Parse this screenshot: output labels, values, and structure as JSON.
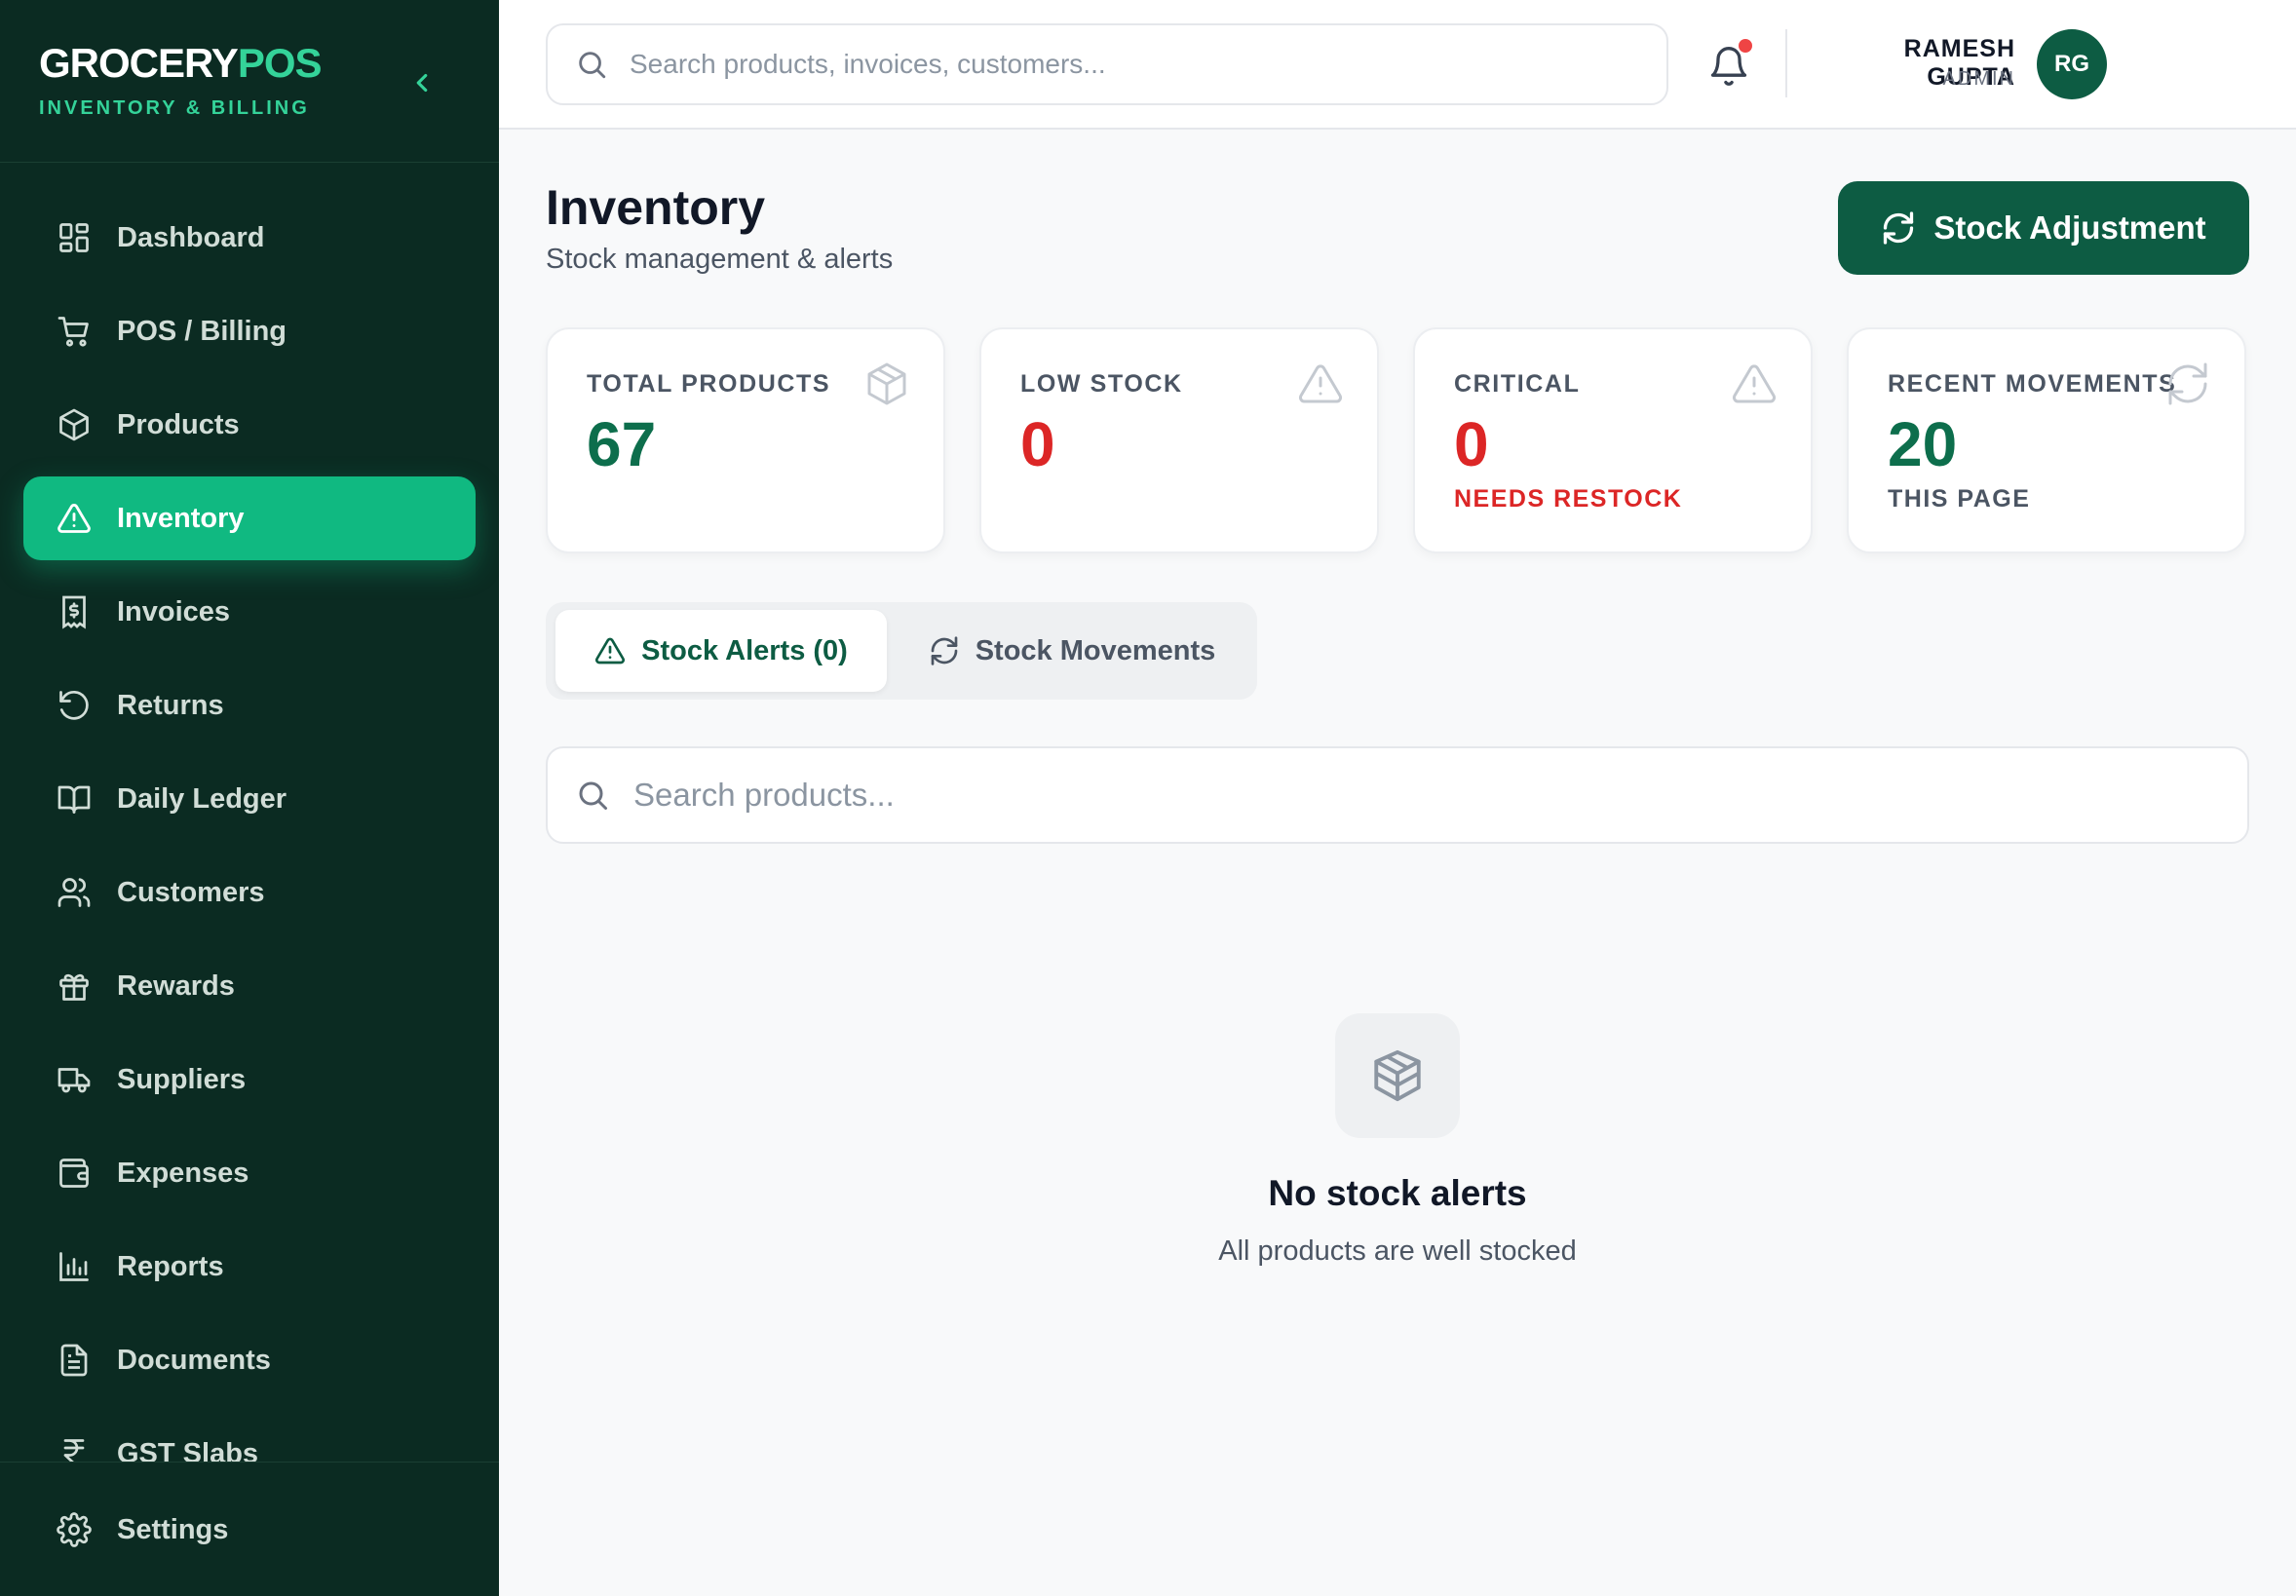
{
  "brand": {
    "name_part1": "GROCERY",
    "name_part2": "POS",
    "subtitle": "INVENTORY & BILLING"
  },
  "sidebar": {
    "items": [
      {
        "label": "Dashboard",
        "icon": "dashboard-icon"
      },
      {
        "label": "POS / Billing",
        "icon": "cart-icon"
      },
      {
        "label": "Products",
        "icon": "package-icon"
      },
      {
        "label": "Inventory",
        "icon": "alert-triangle-icon",
        "active": true
      },
      {
        "label": "Invoices",
        "icon": "receipt-icon"
      },
      {
        "label": "Returns",
        "icon": "rotate-ccw-icon"
      },
      {
        "label": "Daily Ledger",
        "icon": "book-open-icon"
      },
      {
        "label": "Customers",
        "icon": "users-icon"
      },
      {
        "label": "Rewards",
        "icon": "gift-icon"
      },
      {
        "label": "Suppliers",
        "icon": "truck-icon"
      },
      {
        "label": "Expenses",
        "icon": "wallet-icon"
      },
      {
        "label": "Reports",
        "icon": "bar-chart-icon"
      },
      {
        "label": "Documents",
        "icon": "file-text-icon"
      },
      {
        "label": "GST Slabs",
        "icon": "rupee-icon"
      }
    ],
    "settings_label": "Settings"
  },
  "header": {
    "search_placeholder": "Search products, invoices, customers...",
    "user_name": "RAMESH GUPTA",
    "user_role": "ADMIN",
    "avatar_initials": "RG"
  },
  "page": {
    "title": "Inventory",
    "subtitle": "Stock management & alerts",
    "action_button": "Stock Adjustment"
  },
  "stats": [
    {
      "label": "TOTAL PRODUCTS",
      "value": "67",
      "note": "",
      "icon": "box-icon"
    },
    {
      "label": "LOW STOCK",
      "value": "0",
      "note": "",
      "icon": "alert-triangle-icon"
    },
    {
      "label": "CRITICAL",
      "value": "0",
      "note": "NEEDS RESTOCK",
      "icon": "alert-triangle-icon"
    },
    {
      "label": "RECENT MOVEMENTS",
      "value": "20",
      "note": "THIS PAGE",
      "icon": "refresh-icon"
    }
  ],
  "tabs": [
    {
      "label": "Stock Alerts (0)",
      "active": true
    },
    {
      "label": "Stock Movements",
      "active": false
    }
  ],
  "product_search_placeholder": "Search products...",
  "empty_state": {
    "title": "No stock alerts",
    "subtitle": "All products are well stocked"
  },
  "colors": {
    "sidebar_bg": "#0b2b22",
    "accent": "#10b981",
    "primary": "#0d5c43",
    "danger": "#dc2626"
  }
}
